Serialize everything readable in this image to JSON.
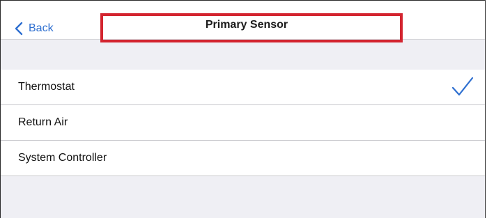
{
  "navbar": {
    "back_label": "Back",
    "title": "Primary Sensor"
  },
  "options": [
    {
      "label": "Thermostat",
      "selected": true
    },
    {
      "label": "Return Air",
      "selected": false
    },
    {
      "label": "System Controller",
      "selected": false
    }
  ],
  "colors": {
    "accent": "#2e6fd0",
    "highlight_box": "#d3242f",
    "group_background": "#efeff4"
  }
}
